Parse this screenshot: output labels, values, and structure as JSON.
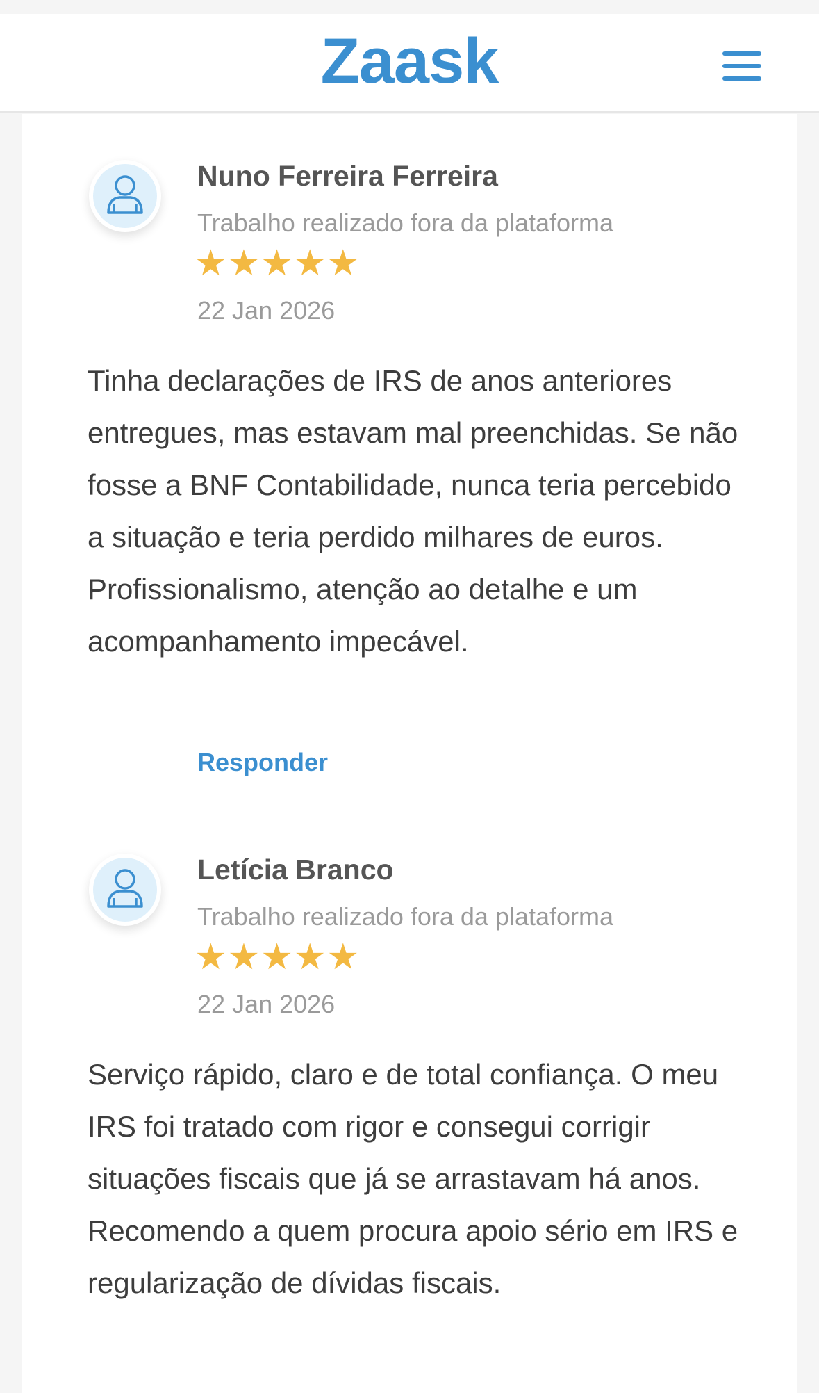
{
  "header": {
    "logo_text": "Zaask",
    "menu_icon": "hamburger-menu-icon",
    "brand_color": "#3b8fd0"
  },
  "reviews": [
    {
      "name": "Nuno Ferreira Ferreira",
      "source": "Trabalho realizado fora da plataforma",
      "rating": 5,
      "date": "22 Jan 2026",
      "text": "Tinha declarações de IRS de anos anteriores entregues, mas estavam mal preenchidas. Se não fosse a BNF Contabilidade, nunca teria percebido a situação e teria perdido milhares de euros. Profissionalismo, atenção ao detalhe e um acompanhamento impecável.",
      "reply_label": "Responder",
      "avatar_icon": "user-avatar-icon"
    },
    {
      "name": "Letícia Branco",
      "source": "Trabalho realizado fora da plataforma",
      "rating": 5,
      "date": "22 Jan 2026",
      "text": "Serviço rápido, claro e de total confiança. O meu IRS foi tratado com rigor e consegui corrigir situações fiscais que já se arrastavam há anos. Recomendo a quem procura apoio sério em IRS e regularização de dívidas fiscais.",
      "avatar_icon": "user-avatar-icon"
    }
  ],
  "colors": {
    "star": "#f3b942",
    "link": "#3b8fd0",
    "avatar_fill": "#dff0fb"
  }
}
